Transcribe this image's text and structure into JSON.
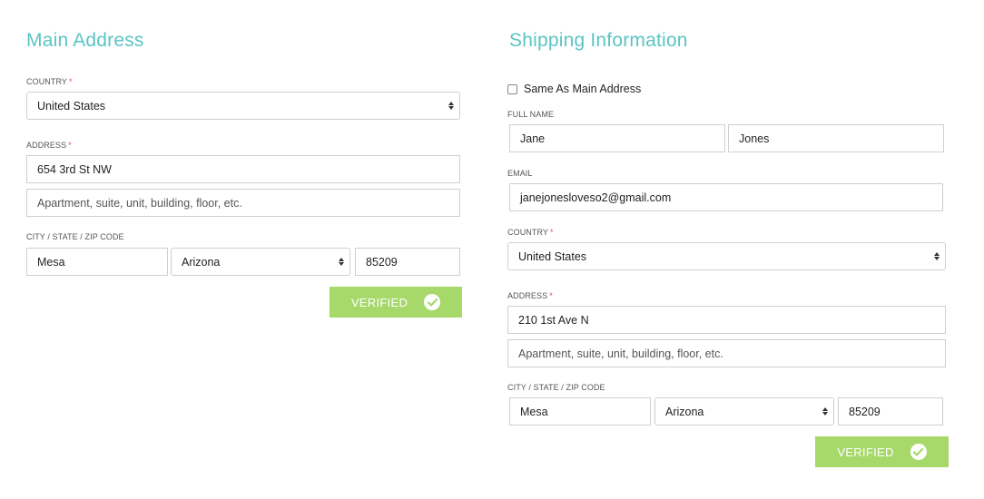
{
  "main": {
    "title": "Main Address",
    "country_label": "COUNTRY",
    "country_value": "United States",
    "address_label": "ADDRESS",
    "address_line1": "654 3rd St NW",
    "address_line2_placeholder": "Apartment, suite, unit, building, floor, etc.",
    "csz_label": "CITY / STATE / ZIP CODE",
    "city": "Mesa",
    "state": "Arizona",
    "zip": "85209",
    "verified_label": "VERIFIED"
  },
  "shipping": {
    "title": "Shipping Information",
    "same_as_label": "Same As Main Address",
    "same_as_checked": false,
    "fullname_label": "FULL NAME",
    "first_name": "Jane",
    "last_name": "Jones",
    "email_label": "EMAIL",
    "email": "janejonesloveso2@gmail.com",
    "country_label": "COUNTRY",
    "country_value": "United States",
    "address_label": "ADDRESS",
    "address_line1": "210 1st Ave N",
    "address_line2_placeholder": "Apartment, suite, unit, building, floor, etc.",
    "csz_label": "CITY / STATE / ZIP CODE",
    "city": "Mesa",
    "state": "Arizona",
    "zip": "85209",
    "verified_label": "VERIFIED"
  },
  "required_marker": "*",
  "colors": {
    "accent": "#5bc4c4",
    "verified": "#a6d86a",
    "required": "#d9534f"
  },
  "icons": {
    "select": "select-arrows-icon",
    "verified": "check-circle-icon"
  }
}
